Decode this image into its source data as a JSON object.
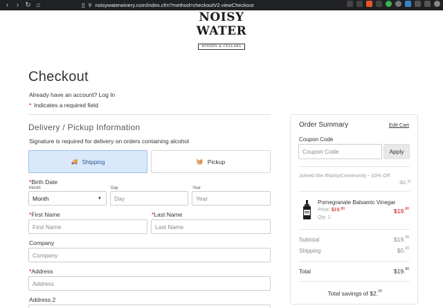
{
  "browser": {
    "url": "noisywaterwinery.com/index.cfm?method=checkoutV2.viewCheckout"
  },
  "logo": {
    "brand": "NOISY WATER",
    "tagline": "WINERY & CELLARS"
  },
  "page": {
    "title": "Checkout",
    "account_prompt": "Already have an account? Log In",
    "required_note": "Indicates a required field",
    "required_star": "*"
  },
  "delivery": {
    "title": "Delivery / Pickup Information",
    "signature_note": "Signature is required for delivery on orders containing alcohol",
    "tabs": [
      {
        "label": "Shipping",
        "icon": "truck-icon",
        "selected": true
      },
      {
        "label": "Pickup",
        "icon": "basket-icon",
        "selected": false
      }
    ]
  },
  "form": {
    "birth_date": {
      "label": "Birth Date",
      "month_label": "Month",
      "month_value": "Month",
      "day_label": "Day",
      "day_placeholder": "Day",
      "year_label": "Year",
      "year_placeholder": "Year"
    },
    "first_name": {
      "label": "First Name",
      "placeholder": "First Name"
    },
    "last_name": {
      "label": "Last Name",
      "placeholder": "Last Name"
    },
    "company": {
      "label": "Company",
      "placeholder": "Company"
    },
    "address": {
      "label": "Address",
      "placeholder": "Address"
    },
    "address2": {
      "label": "Address 2"
    }
  },
  "summary": {
    "title": "Order Summary",
    "edit_cart": "Edit Cart",
    "coupon_label": "Coupon Code",
    "coupon_placeholder": "Coupon Code",
    "apply_label": "Apply",
    "promo_text": "Joined the #NoisyCommunity - 10% Off",
    "promo_amount_main": "-$2.",
    "promo_amount_cents": "20",
    "product": {
      "name": "Pomegranate Balsamic Vinegar",
      "price_label": "Price:",
      "price_main": "$19.",
      "price_cents": "80",
      "qty": "Qty: 1",
      "total_main": "$19.",
      "total_cents": "80"
    },
    "subtotal_label": "Subtotal",
    "subtotal_main": "$19.",
    "subtotal_cents": "80",
    "shipping_label": "Shipping",
    "shipping_main": "$0.",
    "shipping_cents": "00",
    "total_label": "Total",
    "total_main": "$19.",
    "total_cents": "80",
    "savings_label": "Total savings of",
    "savings_main": "$2.",
    "savings_cents": "20"
  },
  "colors": {
    "required": "#cc0000",
    "shipping_tab_bg": "#d9e8fb",
    "price_red": "#cc0000"
  }
}
